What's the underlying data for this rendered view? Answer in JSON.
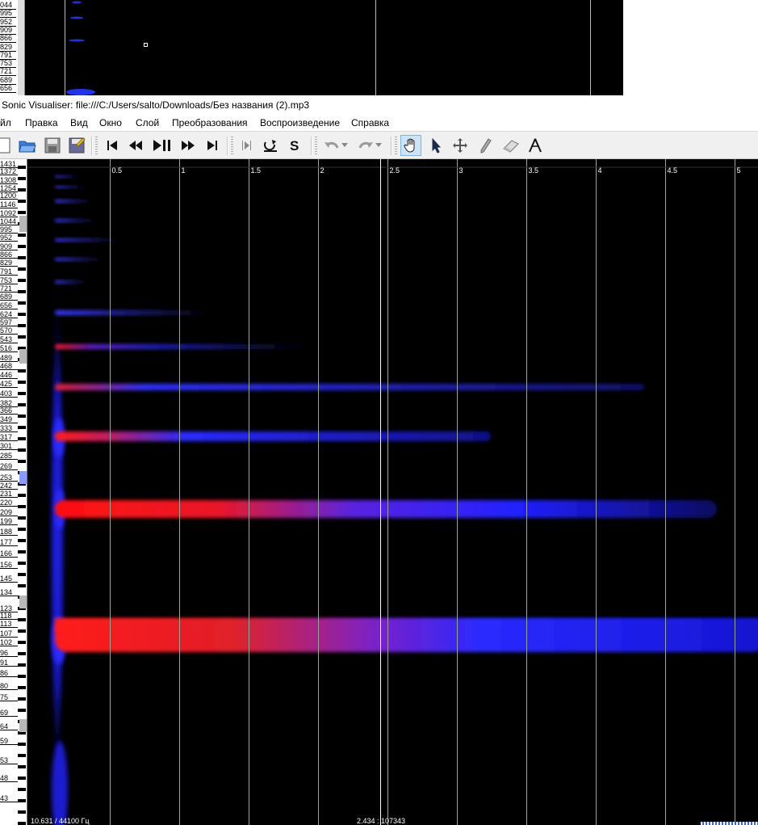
{
  "top_fragment": {
    "freq_labels": [
      "044",
      "995",
      "952",
      "909",
      "866",
      "829",
      "791",
      "753",
      "721",
      "689",
      "656"
    ]
  },
  "window": {
    "title": "Sonic Visualiser: file:///C:/Users/salto/Downloads/Без названия (2).mp3"
  },
  "menu": [
    "йл",
    "Правка",
    "Вид",
    "Окно",
    "Слой",
    "Преобразования",
    "Воспроизведение",
    "Справка"
  ],
  "toolbar": {
    "icons": [
      "new-file-icon",
      "open-folder-icon",
      "save-icon",
      "save-session-icon",
      "rewind-start-icon",
      "rewind-icon",
      "play-pause-icon",
      "fast-forward-icon",
      "fast-forward-end-icon",
      "constrain-playback-icon",
      "loop-playback-icon",
      "solo-icon",
      "undo-icon",
      "redo-icon",
      "navigate-hand-icon",
      "select-arrow-icon",
      "move-icon",
      "draw-pencil-icon",
      "erase-icon",
      "measure-icon"
    ],
    "active_tool": "navigate-hand-icon"
  },
  "spectrogram": {
    "freq_labels": [
      "1431",
      "1372",
      "1308",
      "1254",
      "1200",
      "1146",
      "1092",
      "1044",
      "995",
      "952",
      "909",
      "866",
      "829",
      "791",
      "753",
      "721",
      "689",
      "656",
      "624",
      "597",
      "570",
      "543",
      "516",
      "489",
      "468",
      "446",
      "425",
      "403",
      "382",
      "366",
      "349",
      "333",
      "317",
      "301",
      "285",
      "269",
      "253",
      "242",
      "231",
      "220",
      "209",
      "199",
      "188",
      "177",
      "166",
      "156",
      "145",
      "134",
      "123",
      "118",
      "113",
      "107",
      "102",
      "96",
      "91",
      "86",
      "80",
      "75",
      "69",
      "64",
      "59",
      "53",
      "48",
      "43"
    ],
    "time_labels": [
      "0.5",
      "1",
      "1.5",
      "2",
      "2.5",
      "3",
      "3.5",
      "4",
      "4.5",
      "5"
    ],
    "status_left": "10.631 / 44100 Гц",
    "status_mid": "2.434 : 107343",
    "colors": {
      "background": "#000000",
      "low": "#1a1aff",
      "high": "#ff1a1a"
    }
  }
}
